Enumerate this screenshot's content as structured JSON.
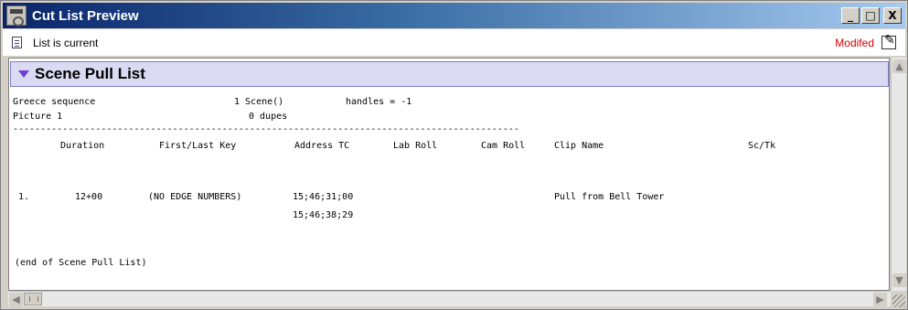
{
  "window": {
    "title": "Cut List Preview",
    "minimize_label": "_",
    "maximize_label": "□",
    "close_label": "X"
  },
  "status": {
    "list_status": "List is current",
    "modified_label": "Modifed"
  },
  "section": {
    "title": "Scene Pull List"
  },
  "header_info": {
    "sequence_name": "Greece sequence",
    "scene_count": "1 Scene()",
    "handles": "handles = -1",
    "picture": "Picture 1",
    "dupes": "0 dupes",
    "divider": "--------------------------------------------------------------------------------------------"
  },
  "table": {
    "columns": [
      "Duration",
      "First/Last Key",
      "Address TC",
      "Lab Roll",
      "Cam Roll",
      "Clip Name",
      "Sc/Tk"
    ],
    "rows": [
      {
        "index": "1.",
        "duration": "12+00",
        "first_last_key": "(NO EDGE NUMBERS)",
        "address_tc_start": "15;46;31;00",
        "address_tc_end": "15;46;38;29",
        "lab_roll": "",
        "cam_roll": "",
        "clip_name": "Pull from Bell Tower",
        "sc_tk": ""
      }
    ]
  },
  "footer_text": "(end of Scene Pull List)",
  "colors": {
    "title_gradient_start": "#0a246a",
    "section_header_bg": "#dadaf2",
    "triangle": "#6b3fd0",
    "modified": "#d40000"
  },
  "icons": {
    "app": "cut-list-app-icon",
    "document": "document-icon",
    "edit": "edit-pencil-icon",
    "disclosure": "disclosure-triangle-icon"
  }
}
